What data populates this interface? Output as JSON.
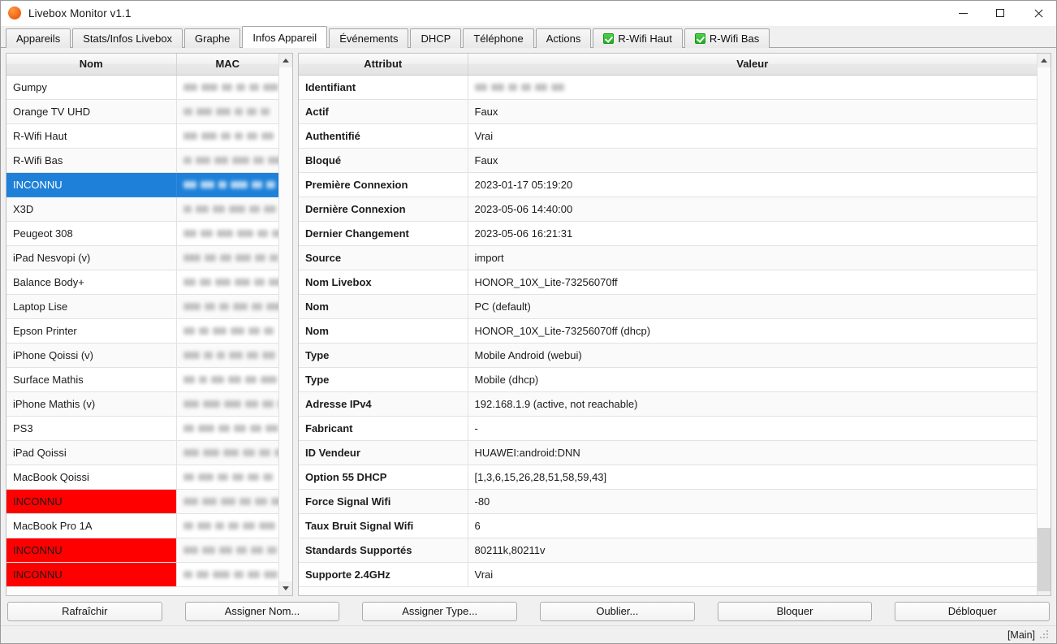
{
  "window": {
    "title": "Livebox Monitor v1.1",
    "icon": "livebox-orange-icon",
    "controls": {
      "minimize": "minimize-icon",
      "maximize": "maximize-icon",
      "close": "close-icon"
    }
  },
  "tabs": [
    {
      "label": "Appareils",
      "active": false,
      "checkbox": false
    },
    {
      "label": "Stats/Infos Livebox",
      "active": false,
      "checkbox": false
    },
    {
      "label": "Graphe",
      "active": false,
      "checkbox": false
    },
    {
      "label": "Infos Appareil",
      "active": true,
      "checkbox": false
    },
    {
      "label": "Événements",
      "active": false,
      "checkbox": false
    },
    {
      "label": "DHCP",
      "active": false,
      "checkbox": false
    },
    {
      "label": "Téléphone",
      "active": false,
      "checkbox": false
    },
    {
      "label": "Actions",
      "active": false,
      "checkbox": false
    },
    {
      "label": "R-Wifi Haut",
      "active": false,
      "checkbox": true
    },
    {
      "label": "R-Wifi Bas",
      "active": false,
      "checkbox": true
    }
  ],
  "device_list": {
    "columns": [
      "Nom",
      "MAC"
    ],
    "rows": [
      {
        "nom": "Gumpy",
        "mac": "redacted",
        "state": "normal"
      },
      {
        "nom": "Orange TV UHD",
        "mac": "redacted",
        "state": "normal"
      },
      {
        "nom": "R-Wifi Haut",
        "mac": "redacted",
        "state": "normal"
      },
      {
        "nom": "R-Wifi Bas",
        "mac": "redacted",
        "state": "normal"
      },
      {
        "nom": "INCONNU",
        "mac": "redacted",
        "state": "selected"
      },
      {
        "nom": "X3D",
        "mac": "redacted",
        "state": "normal"
      },
      {
        "nom": "Peugeot 308",
        "mac": "redacted",
        "state": "normal"
      },
      {
        "nom": "iPad Nesvopi (v)",
        "mac": "redacted",
        "state": "normal"
      },
      {
        "nom": "Balance Body+",
        "mac": "redacted",
        "state": "normal"
      },
      {
        "nom": "Laptop Lise",
        "mac": "redacted",
        "state": "normal"
      },
      {
        "nom": "Epson Printer",
        "mac": "redacted",
        "state": "normal"
      },
      {
        "nom": "iPhone Qoissi (v)",
        "mac": "redacted",
        "state": "normal"
      },
      {
        "nom": "Surface Mathis",
        "mac": "redacted",
        "state": "normal"
      },
      {
        "nom": "iPhone Mathis (v)",
        "mac": "redacted",
        "state": "normal"
      },
      {
        "nom": "PS3",
        "mac": "redacted",
        "state": "normal"
      },
      {
        "nom": "iPad Qoissi",
        "mac": "redacted",
        "state": "normal"
      },
      {
        "nom": "MacBook Qoissi",
        "mac": "redacted",
        "state": "normal"
      },
      {
        "nom": "INCONNU",
        "mac": "redacted",
        "state": "alert"
      },
      {
        "nom": "MacBook Pro 1A",
        "mac": "redacted",
        "state": "normal"
      },
      {
        "nom": "INCONNU",
        "mac": "redacted",
        "state": "alert"
      },
      {
        "nom": "INCONNU",
        "mac": "redacted",
        "state": "alert"
      }
    ]
  },
  "device_info": {
    "columns": [
      "Attribut",
      "Valeur"
    ],
    "rows": [
      {
        "attribut": "Identifiant",
        "valeur": "redacted"
      },
      {
        "attribut": "Actif",
        "valeur": "Faux"
      },
      {
        "attribut": "Authentifié",
        "valeur": "Vrai"
      },
      {
        "attribut": "Bloqué",
        "valeur": "Faux"
      },
      {
        "attribut": "Première Connexion",
        "valeur": "2023-01-17 05:19:20"
      },
      {
        "attribut": "Dernière Connexion",
        "valeur": "2023-05-06 14:40:00"
      },
      {
        "attribut": "Dernier Changement",
        "valeur": "2023-05-06 16:21:31"
      },
      {
        "attribut": "Source",
        "valeur": "import"
      },
      {
        "attribut": "Nom Livebox",
        "valeur": "HONOR_10X_Lite-73256070ff"
      },
      {
        "attribut": "Nom",
        "valeur": "PC (default)"
      },
      {
        "attribut": "Nom",
        "valeur": "HONOR_10X_Lite-73256070ff (dhcp)"
      },
      {
        "attribut": "Type",
        "valeur": "Mobile Android (webui)"
      },
      {
        "attribut": "Type",
        "valeur": "Mobile (dhcp)"
      },
      {
        "attribut": "Adresse IPv4",
        "valeur": "192.168.1.9 (active, not reachable)"
      },
      {
        "attribut": "Fabricant",
        "valeur": "-"
      },
      {
        "attribut": "ID Vendeur",
        "valeur": "HUAWEI:android:DNN"
      },
      {
        "attribut": "Option 55 DHCP",
        "valeur": "[1,3,6,15,26,28,51,58,59,43]"
      },
      {
        "attribut": "Force Signal Wifi",
        "valeur": "-80"
      },
      {
        "attribut": "Taux Bruit Signal Wifi",
        "valeur": "6"
      },
      {
        "attribut": "Standards Supportés",
        "valeur": "80211k,80211v"
      },
      {
        "attribut": "Supporte 2.4GHz",
        "valeur": "Vrai"
      }
    ]
  },
  "buttons": [
    {
      "label": "Rafraîchir"
    },
    {
      "label": "Assigner Nom..."
    },
    {
      "label": "Assigner Type..."
    },
    {
      "label": "Oublier..."
    },
    {
      "label": "Bloquer"
    },
    {
      "label": "Débloquer"
    }
  ],
  "statusbar": {
    "text": "[Main]"
  },
  "colors": {
    "selection": "#1e80d8",
    "alert": "#ff0000",
    "checkbox_green": "#1fab1f",
    "app_icon": "#f26b1d"
  }
}
